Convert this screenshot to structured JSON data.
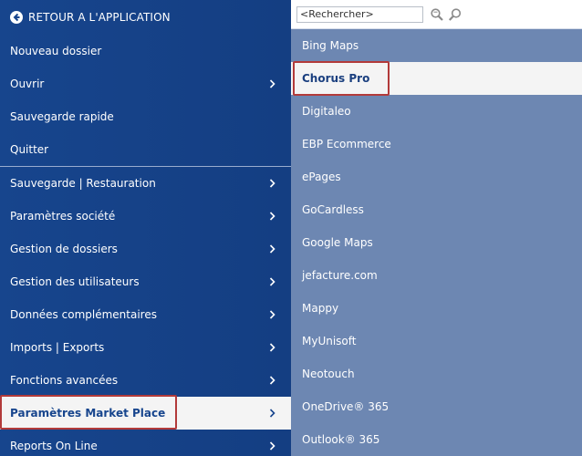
{
  "left_menu": {
    "back_label": "RETOUR A L'APPLICATION",
    "items_top": [
      {
        "label": "Nouveau dossier",
        "has_arrow": false
      },
      {
        "label": "Ouvrir",
        "has_arrow": true
      },
      {
        "label": "Sauvegarde rapide",
        "has_arrow": false
      },
      {
        "label": "Quitter",
        "has_arrow": false
      }
    ],
    "items_bottom": [
      {
        "label": "Sauvegarde | Restauration",
        "has_arrow": true
      },
      {
        "label": "Paramètres société",
        "has_arrow": true
      },
      {
        "label": "Gestion de dossiers",
        "has_arrow": true
      },
      {
        "label": "Gestion des utilisateurs",
        "has_arrow": true
      },
      {
        "label": "Données complémentaires",
        "has_arrow": true
      },
      {
        "label": "Imports | Exports",
        "has_arrow": true
      },
      {
        "label": "Fonctions avancées",
        "has_arrow": true
      },
      {
        "label": "Paramètres Market Place",
        "has_arrow": true,
        "selected": true
      },
      {
        "label": "Reports On Line",
        "has_arrow": true
      }
    ]
  },
  "right_panel": {
    "search_placeholder": "<Rechercher>",
    "items": [
      {
        "label": "Bing Maps"
      },
      {
        "label": "Chorus Pro",
        "selected": true
      },
      {
        "label": "Digitaleo"
      },
      {
        "label": "EBP Ecommerce"
      },
      {
        "label": "ePages"
      },
      {
        "label": "GoCardless"
      },
      {
        "label": "Google Maps"
      },
      {
        "label": "jefacture.com"
      },
      {
        "label": "Mappy"
      },
      {
        "label": "MyUnisoft"
      },
      {
        "label": "Neotouch"
      },
      {
        "label": "OneDrive® 365"
      },
      {
        "label": "Outlook® 365"
      }
    ]
  },
  "colors": {
    "menu_bg": "#17458d",
    "right_bg": "#6d87b2",
    "highlight_outline": "#b23a3a",
    "selected_bg": "#f4f4f4"
  },
  "icons": {
    "back": "arrow-left-circle-icon",
    "chevron": "chevron-right-icon",
    "search": "search-icon",
    "advanced_search": "advanced-search-icon"
  }
}
